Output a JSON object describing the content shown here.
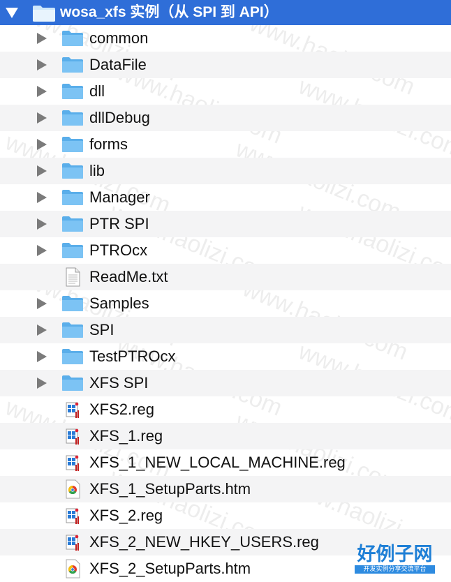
{
  "folder": {
    "name": "wosa_xfs 实例（从 SPI 到 API）"
  },
  "items": [
    {
      "label": "common",
      "type": "folder"
    },
    {
      "label": "DataFile",
      "type": "folder"
    },
    {
      "label": "dll",
      "type": "folder"
    },
    {
      "label": "dllDebug",
      "type": "folder"
    },
    {
      "label": "forms",
      "type": "folder"
    },
    {
      "label": "lib",
      "type": "folder"
    },
    {
      "label": "Manager",
      "type": "folder"
    },
    {
      "label": "PTR SPI",
      "type": "folder"
    },
    {
      "label": "PTROcx",
      "type": "folder"
    },
    {
      "label": "ReadMe.txt",
      "type": "text-file"
    },
    {
      "label": "Samples",
      "type": "folder"
    },
    {
      "label": "SPI",
      "type": "folder"
    },
    {
      "label": "TestPTROcx",
      "type": "folder"
    },
    {
      "label": "XFS SPI",
      "type": "folder"
    },
    {
      "label": "XFS2.reg",
      "type": "reg-file"
    },
    {
      "label": "XFS_1.reg",
      "type": "reg-file"
    },
    {
      "label": "XFS_1_NEW_LOCAL_MACHINE.reg",
      "type": "reg-file"
    },
    {
      "label": "XFS_1_SetupParts.htm",
      "type": "htm-file"
    },
    {
      "label": "XFS_2.reg",
      "type": "reg-file"
    },
    {
      "label": "XFS_2_NEW_HKEY_USERS.reg",
      "type": "reg-file"
    },
    {
      "label": "XFS_2_SetupParts.htm",
      "type": "htm-file"
    }
  ],
  "watermark": {
    "text": "www.haolizi.com"
  },
  "brand": {
    "title": "好例子网",
    "subtitle": "开发实例分享交流平台"
  },
  "colors": {
    "selection": "#2f6ed8",
    "folder": "#6cb9f2",
    "stripe": "#f4f4f5"
  }
}
